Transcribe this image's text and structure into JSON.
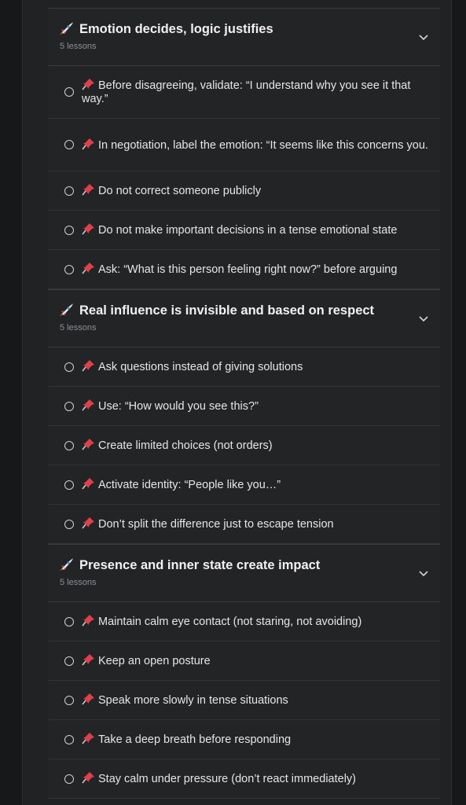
{
  "sections": [
    {
      "title": "Emotion decides, logic justifies",
      "sub": "5 lessons",
      "lessons": [
        "Before disagreeing, validate: “I understand why you see it that way.”",
        "In negotiation, label the emotion: “It seems like this concerns you.",
        "Do not correct someone publicly",
        "Do not make important decisions in a tense emotional state",
        "Ask: “What is this person feeling right now?” before arguing"
      ]
    },
    {
      "title": "Real influence is invisible and based on respect",
      "sub": "5 lessons",
      "lessons": [
        "Ask questions instead of giving solutions",
        "Use: “How would you see this?”",
        "Create limited choices (not orders)",
        "Activate identity: “People like you…”",
        "Don’t split the difference just to escape tension"
      ]
    },
    {
      "title": "Presence and inner state create impact",
      "sub": "5 lessons",
      "lessons": [
        "Maintain calm eye contact (not staring, not avoiding)",
        "Keep an open posture",
        "Speak more slowly in tense situations",
        "Take a deep breath before responding",
        "Stay calm under pressure (don’t react immediately)"
      ]
    }
  ],
  "icons": {
    "section": "rocket-icon",
    "lesson": "pushpin-icon",
    "toggle": "chevron-down-icon",
    "status": "radio-unchecked-icon"
  },
  "colors": {
    "background": "#1c1d1f",
    "panel": "#232426",
    "text": "#e6e6e6",
    "muted": "#8d8f93",
    "pin": "#e0404a"
  }
}
